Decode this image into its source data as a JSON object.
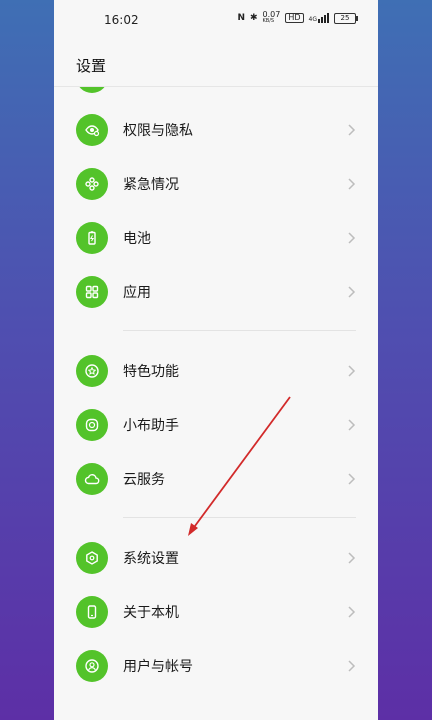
{
  "status_bar": {
    "time": "16:02",
    "nfc": "N",
    "bluetooth": "✱",
    "net_speed_value": "0.07",
    "net_speed_unit": "KB/S",
    "hd_badge": "HD",
    "signal_label": "4G",
    "battery_level": "25"
  },
  "header": {
    "title": "设置"
  },
  "menu": [
    {
      "label": "权限与隐私",
      "icon": "privacy-icon"
    },
    {
      "label": "紧急情况",
      "icon": "emergency-icon"
    },
    {
      "label": "电池",
      "icon": "battery-icon"
    },
    {
      "label": "应用",
      "icon": "apps-icon"
    },
    {
      "label": "特色功能",
      "icon": "special-features-icon"
    },
    {
      "label": "小布助手",
      "icon": "assistant-icon"
    },
    {
      "label": "云服务",
      "icon": "cloud-icon"
    },
    {
      "label": "系统设置",
      "icon": "system-settings-icon"
    },
    {
      "label": "关于本机",
      "icon": "phone-icon"
    },
    {
      "label": "用户与帐号",
      "icon": "user-account-icon"
    }
  ],
  "colors": {
    "accent_green": "#53c32a",
    "annotation_arrow": "#d22a2a"
  }
}
